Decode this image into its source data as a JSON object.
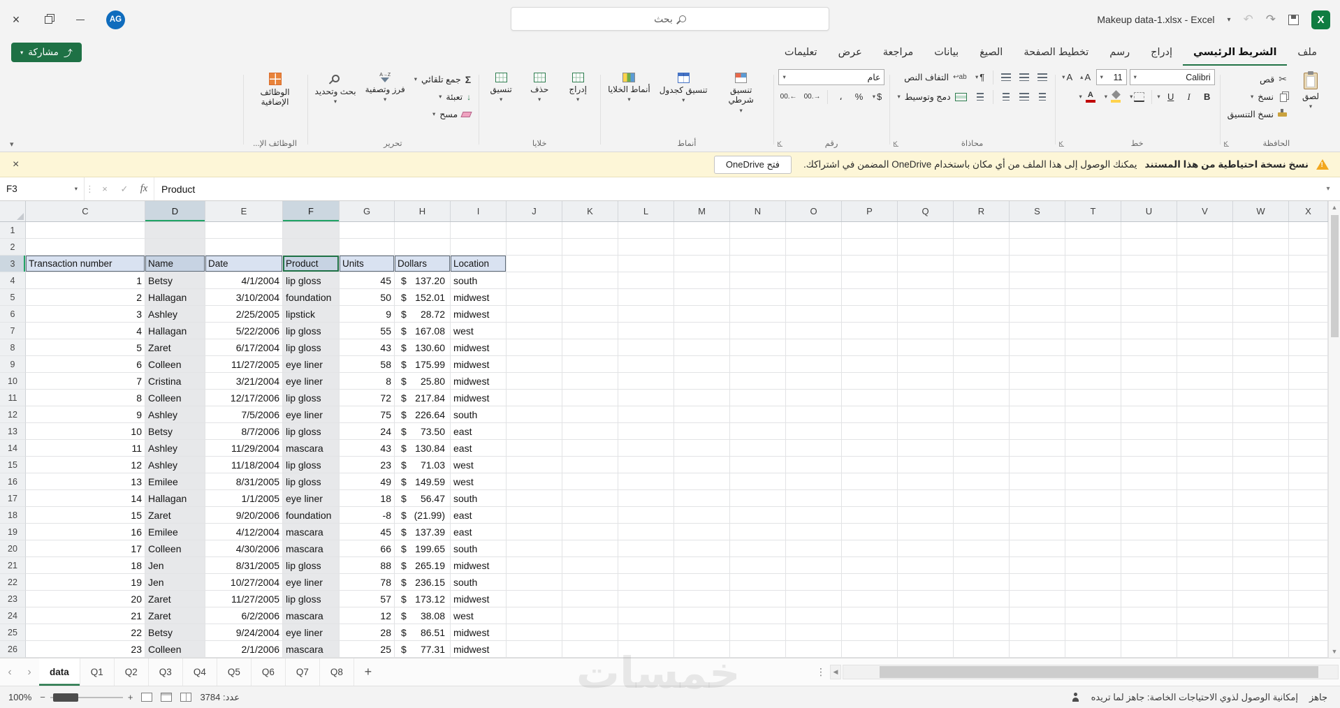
{
  "titlebar": {
    "avatar": "AG",
    "search_placeholder": "بحث",
    "file_title": "Makeup data-1.xlsx  -  Excel"
  },
  "ribbon_tabs": {
    "share": "مشاركة",
    "tabs": [
      "ملف",
      "الشريط الرئيسي",
      "إدراج",
      "رسم",
      "تخطيط الصفحة",
      "الصيغ",
      "بيانات",
      "مراجعة",
      "عرض",
      "تعليمات"
    ],
    "active": "الشريط الرئيسي"
  },
  "ribbon": {
    "clipboard": {
      "group": "الحافظة",
      "paste": "لصق",
      "cut": "قص",
      "copy": "نسخ",
      "painter": "نسخ التنسيق"
    },
    "font": {
      "group": "خط",
      "name": "Calibri",
      "size": "11"
    },
    "alignment": {
      "group": "محاذاة",
      "wrap": "التفاف النص",
      "merge": "دمج وتوسيط"
    },
    "number": {
      "group": "رقم",
      "format": "عام"
    },
    "styles": {
      "group": "أنماط",
      "conditional": "تنسيق شرطي",
      "as_table": "تنسيق كجدول",
      "cell_styles": "أنماط الخلايا"
    },
    "cells": {
      "group": "خلايا",
      "insert": "إدراج",
      "delete": "حذف",
      "format": "تنسيق"
    },
    "editing": {
      "group": "تحرير",
      "autosum": "جمع تلقائي",
      "fill": "تعبئة",
      "clear": "مسح",
      "sort": "فرز وتصفية",
      "find": "بحث وتحديد"
    },
    "addins": {
      "group": "الوظائف الإ...",
      "button": "الوظائف الإضافية"
    }
  },
  "message_bar": {
    "title": "نسخ نسخة احتياطية من هذا المستند",
    "text": "يمكنك الوصول إلى هذا الملف من أي مكان باستخدام OneDrive المضمن في اشتراكك.",
    "action": "فتح OneDrive"
  },
  "formula_bar": {
    "name_box": "F3",
    "fx": "fx",
    "content": "Product"
  },
  "grid": {
    "column_letters": [
      "C",
      "D",
      "E",
      "F",
      "G",
      "H",
      "I",
      "J",
      "K",
      "L",
      "M",
      "N",
      "O",
      "P",
      "Q",
      "R",
      "S",
      "T",
      "U",
      "V",
      "W",
      "X"
    ],
    "selected_columns": [
      "D",
      "F"
    ],
    "active_cell": "F3",
    "visible_rows": 26,
    "currency": "$",
    "table_header": [
      "Transaction number",
      "Name",
      "Date",
      "Product",
      "Units",
      "Dollars",
      "Location"
    ],
    "table_rows": [
      [
        1,
        "Betsy",
        "4/1/2004",
        "lip gloss",
        45,
        "137.20",
        "south"
      ],
      [
        2,
        "Hallagan",
        "3/10/2004",
        "foundation",
        50,
        "152.01",
        "midwest"
      ],
      [
        3,
        "Ashley",
        "2/25/2005",
        "lipstick",
        9,
        "28.72",
        "midwest"
      ],
      [
        4,
        "Hallagan",
        "5/22/2006",
        "lip gloss",
        55,
        "167.08",
        "west"
      ],
      [
        5,
        "Zaret",
        "6/17/2004",
        "lip gloss",
        43,
        "130.60",
        "midwest"
      ],
      [
        6,
        "Colleen",
        "11/27/2005",
        "eye liner",
        58,
        "175.99",
        "midwest"
      ],
      [
        7,
        "Cristina",
        "3/21/2004",
        "eye liner",
        8,
        "25.80",
        "midwest"
      ],
      [
        8,
        "Colleen",
        "12/17/2006",
        "lip gloss",
        72,
        "217.84",
        "midwest"
      ],
      [
        9,
        "Ashley",
        "7/5/2006",
        "eye liner",
        75,
        "226.64",
        "south"
      ],
      [
        10,
        "Betsy",
        "8/7/2006",
        "lip gloss",
        24,
        "73.50",
        "east"
      ],
      [
        11,
        "Ashley",
        "11/29/2004",
        "mascara",
        43,
        "130.84",
        "east"
      ],
      [
        12,
        "Ashley",
        "11/18/2004",
        "lip gloss",
        23,
        "71.03",
        "west"
      ],
      [
        13,
        "Emilee",
        "8/31/2005",
        "lip gloss",
        49,
        "149.59",
        "west"
      ],
      [
        14,
        "Hallagan",
        "1/1/2005",
        "eye liner",
        18,
        "56.47",
        "south"
      ],
      [
        15,
        "Zaret",
        "9/20/2006",
        "foundation",
        -8,
        "(21.99)",
        "east"
      ],
      [
        16,
        "Emilee",
        "4/12/2004",
        "mascara",
        45,
        "137.39",
        "east"
      ],
      [
        17,
        "Colleen",
        "4/30/2006",
        "mascara",
        66,
        "199.65",
        "south"
      ],
      [
        18,
        "Jen",
        "8/31/2005",
        "lip gloss",
        88,
        "265.19",
        "midwest"
      ],
      [
        19,
        "Jen",
        "10/27/2004",
        "eye liner",
        78,
        "236.15",
        "south"
      ],
      [
        20,
        "Zaret",
        "11/27/2005",
        "lip gloss",
        57,
        "173.12",
        "midwest"
      ],
      [
        21,
        "Zaret",
        "6/2/2006",
        "mascara",
        12,
        "38.08",
        "west"
      ],
      [
        22,
        "Betsy",
        "9/24/2004",
        "eye liner",
        28,
        "86.51",
        "midwest"
      ],
      [
        23,
        "Colleen",
        "2/1/2006",
        "mascara",
        25,
        "77.31",
        "midwest"
      ]
    ]
  },
  "sheet_bar": {
    "tabs": [
      "data",
      "Q1",
      "Q2",
      "Q3",
      "Q4",
      "Q5",
      "Q6",
      "Q7",
      "Q8"
    ],
    "active": "data",
    "add": "+"
  },
  "status_bar": {
    "zoom": "100%",
    "count": "عدد: 3784",
    "accessibility": "إمكانية الوصول لذوي الاحتياجات الخاصة: جاهز لما تريده",
    "ready": "جاهز"
  },
  "watermark": "خمسات",
  "colors": {
    "excel_green": "#217346",
    "excel_logo_green": "#107c41",
    "table_header_blue": "#d9e2f1",
    "selection_gray": "#e7e8ea",
    "message_bar_yellow": "#fdf6d7"
  }
}
